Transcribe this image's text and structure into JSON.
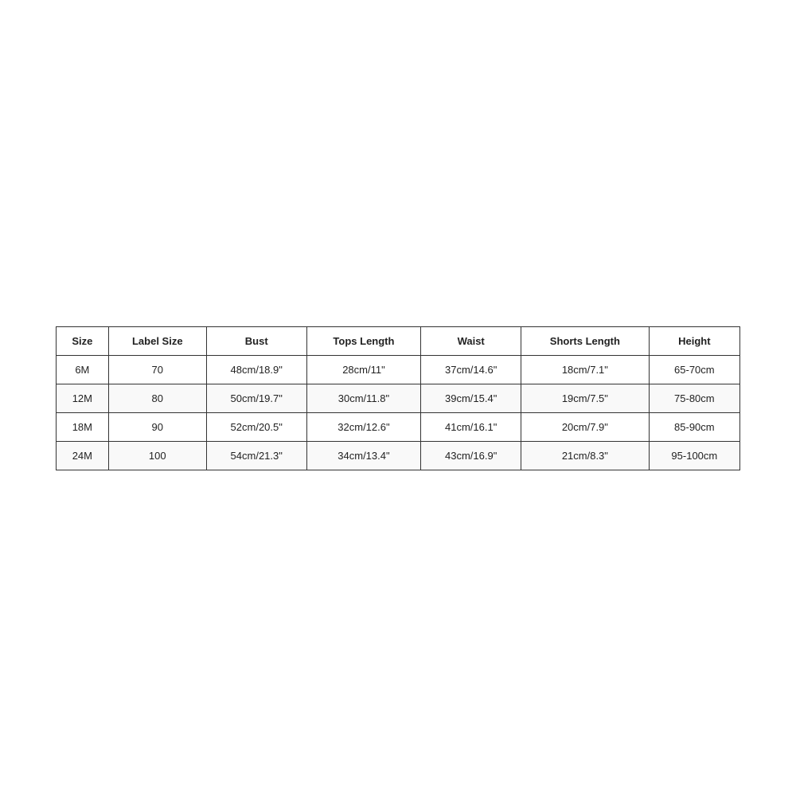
{
  "table": {
    "headers": [
      "Size",
      "Label Size",
      "Bust",
      "Tops Length",
      "Waist",
      "Shorts Length",
      "Height"
    ],
    "rows": [
      {
        "size": "6M",
        "label_size": "70",
        "bust": "48cm/18.9\"",
        "tops_length": "28cm/11\"",
        "waist": "37cm/14.6\"",
        "shorts_length": "18cm/7.1\"",
        "height": "65-70cm"
      },
      {
        "size": "12M",
        "label_size": "80",
        "bust": "50cm/19.7\"",
        "tops_length": "30cm/11.8\"",
        "waist": "39cm/15.4\"",
        "shorts_length": "19cm/7.5\"",
        "height": "75-80cm"
      },
      {
        "size": "18M",
        "label_size": "90",
        "bust": "52cm/20.5\"",
        "tops_length": "32cm/12.6\"",
        "waist": "41cm/16.1\"",
        "shorts_length": "20cm/7.9\"",
        "height": "85-90cm"
      },
      {
        "size": "24M",
        "label_size": "100",
        "bust": "54cm/21.3\"",
        "tops_length": "34cm/13.4\"",
        "waist": "43cm/16.9\"",
        "shorts_length": "21cm/8.3\"",
        "height": "95-100cm"
      }
    ]
  }
}
